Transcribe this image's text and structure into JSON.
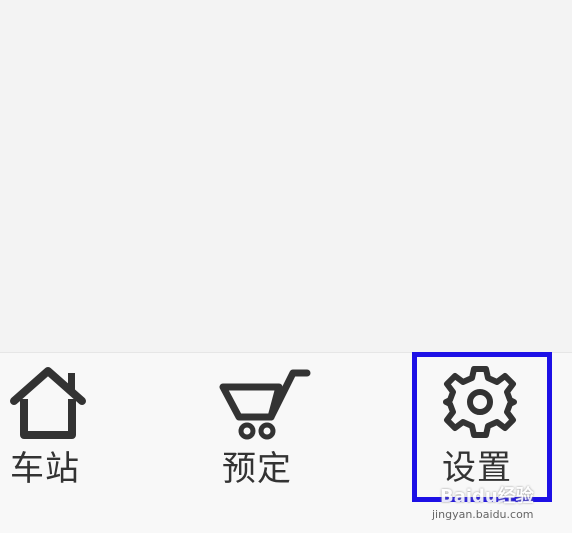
{
  "nav": {
    "items": [
      {
        "label": "车站",
        "icon": "home-icon"
      },
      {
        "label": "预定",
        "icon": "shopping-cart-icon"
      },
      {
        "label": "设置",
        "icon": "gear-icon"
      }
    ],
    "highlight_color": "#1d10e6"
  },
  "watermark": {
    "logo": "Baidu经验",
    "url": "jingyan.baidu.com"
  }
}
